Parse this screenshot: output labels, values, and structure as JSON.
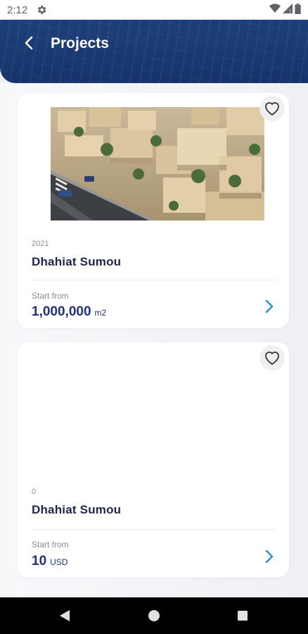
{
  "status_bar": {
    "time": "2:12",
    "icons": [
      "settings-icon",
      "wifi-icon",
      "signal-icon",
      "battery-icon"
    ]
  },
  "header": {
    "title": "Projects",
    "back_icon": "chevron-left-icon"
  },
  "projects": [
    {
      "year": "2021",
      "name": "Dhahiat Sumou",
      "start_label": "Start from",
      "price": "1,000,000",
      "unit": "m2",
      "favorite_icon": "heart-outline-icon",
      "has_image": true
    },
    {
      "year": "0",
      "name": "Dhahiat Sumou",
      "start_label": "Start from",
      "price": "10",
      "unit": "USD",
      "favorite_icon": "heart-outline-icon",
      "has_image": false
    }
  ],
  "nav_bar": {
    "icons": [
      "back-triangle-icon",
      "home-circle-icon",
      "recents-square-icon"
    ]
  },
  "colors": {
    "header_bg": "#1a3a72",
    "price_text": "#21317a",
    "arrow": "#2a8fd0"
  }
}
